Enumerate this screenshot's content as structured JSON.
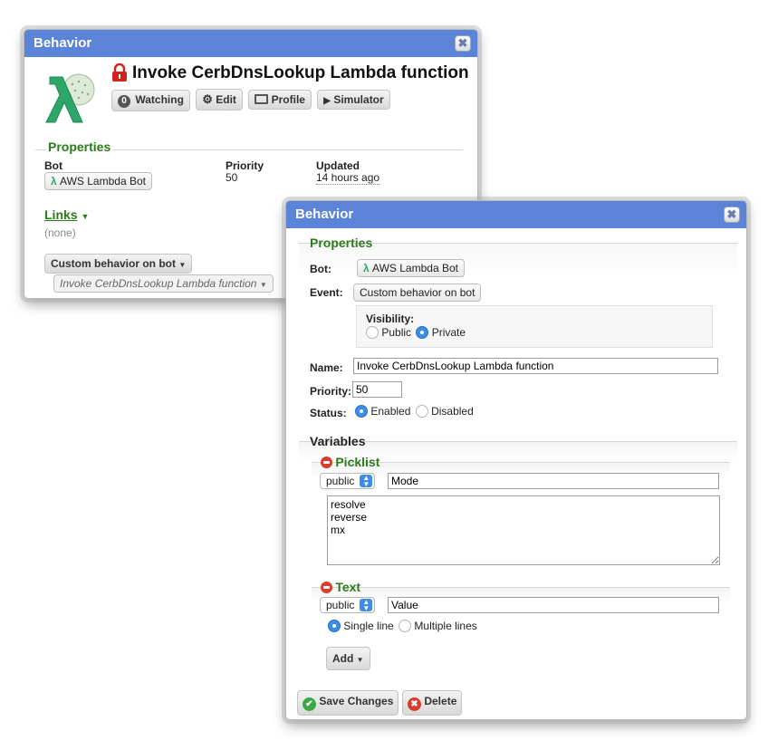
{
  "back_window": {
    "title": "Behavior",
    "close_icon": "✖",
    "heading": "Invoke CerbDnsLookup Lambda function",
    "toolbar": {
      "watching_count": "0",
      "watching_label": "Watching",
      "edit_label": "Edit",
      "profile_label": "Profile",
      "simulator_label": "Simulator"
    },
    "properties": {
      "section_title": "Properties",
      "bot_label": "Bot",
      "bot_value": "AWS Lambda Bot",
      "priority_label": "Priority",
      "priority_value": "50",
      "updated_label": "Updated",
      "updated_value": "14 hours ago"
    },
    "links": {
      "label": "Links",
      "value": "(none)"
    },
    "event_button": "Custom behavior on bot",
    "event_dropdown": "Invoke CerbDnsLookup Lambda function"
  },
  "front_window": {
    "title": "Behavior",
    "close_icon": "✖",
    "properties_title": "Properties",
    "bot_label": "Bot:",
    "bot_value": "AWS Lambda Bot",
    "event_label": "Event:",
    "event_value": "Custom behavior on bot",
    "visibility_label": "Visibility:",
    "visibility_public": "Public",
    "visibility_private": "Private",
    "name_label": "Name:",
    "name_value": "Invoke CerbDnsLookup Lambda function",
    "priority_label": "Priority:",
    "priority_value": "50",
    "status_label": "Status:",
    "status_enabled": "Enabled",
    "status_disabled": "Disabled",
    "variables_title": "Variables",
    "picklist": {
      "title": "Picklist",
      "scope": "public",
      "name": "Mode",
      "options": "resolve\nreverse\nmx"
    },
    "text_var": {
      "title": "Text",
      "scope": "public",
      "name": "Value",
      "single_line": "Single line",
      "multiple_lines": "Multiple lines"
    },
    "add_button": "Add",
    "save_button": "Save Changes",
    "delete_button": "Delete"
  },
  "colors": {
    "titlebar": "#5b84d8",
    "section_green": "#2a7b1a",
    "lambda_green": "#2ea66a",
    "radio_blue": "#3d8de8",
    "delete_red": "#d73c2c",
    "lock_red": "#d0231c"
  },
  "icons": [
    "lambda-logo-icon",
    "lock-icon",
    "gear-icon",
    "profile-card-icon",
    "play-icon",
    "lambda-icon",
    "chevron-down-icon",
    "minus-circle-icon",
    "check-circle-icon",
    "x-circle-icon",
    "close-icon"
  ]
}
